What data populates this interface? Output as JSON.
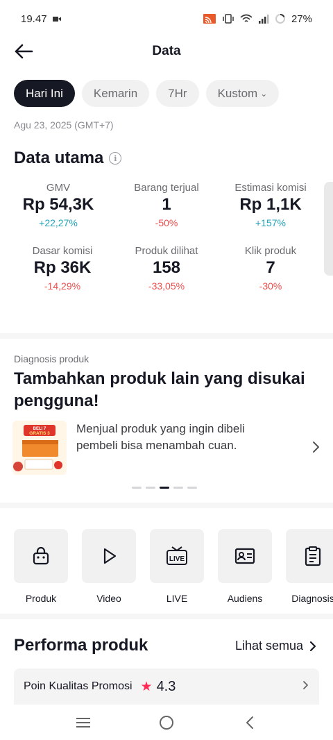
{
  "status_bar": {
    "time": "19.47",
    "battery": "27%"
  },
  "header": {
    "title": "Data"
  },
  "filters": {
    "chips": [
      {
        "label": "Hari Ini"
      },
      {
        "label": "Kemarin"
      },
      {
        "label": "7Hr"
      },
      {
        "label": "Kustom"
      }
    ],
    "selected": "Hari Ini"
  },
  "date_text": "Agu 23, 2025 (GMT+7)",
  "data_utama": {
    "title": "Data utama",
    "metrics": [
      {
        "label": "GMV",
        "value": "Rp 54,3K",
        "change": "+22,27%",
        "trend": "up"
      },
      {
        "label": "Barang terjual",
        "value": "1",
        "change": "-50%",
        "trend": "down"
      },
      {
        "label": "Estimasi komisi",
        "value": "Rp 1,1K",
        "change": "+157%",
        "trend": "up"
      },
      {
        "label": "Dasar komisi",
        "value": "Rp 36K",
        "change": "-14,29%",
        "trend": "down"
      },
      {
        "label": "Produk dilihat",
        "value": "158",
        "change": "-33,05%",
        "trend": "down"
      },
      {
        "label": "Klik produk",
        "value": "7",
        "change": "-30%",
        "trend": "down"
      }
    ]
  },
  "diagnosis": {
    "label": "Diagnosis produk",
    "title": "Tambahkan produk lain yang disukai pengguna!",
    "description": "Menjual produk yang ingin dibeli pembeli bisa menambah cuan.",
    "thumb_text_top": "BELI 7",
    "thumb_text_bottom": "GRATIS 3",
    "slides": 5,
    "active_slide": 2
  },
  "shortcuts": [
    {
      "label": "Produk",
      "icon": "shopping-bag-icon"
    },
    {
      "label": "Video",
      "icon": "play-icon"
    },
    {
      "label": "LIVE",
      "icon": "live-icon",
      "icon_text": "LIVE"
    },
    {
      "label": "Audiens",
      "icon": "id-card-icon"
    },
    {
      "label": "Diagnosis",
      "icon": "clipboard-icon"
    }
  ],
  "performa": {
    "title": "Performa produk",
    "see_all": "Lihat semua",
    "quality_label": "Poin Kualitas Promosi",
    "quality_score": "4.3"
  },
  "colors": {
    "positive": "#20a4b8",
    "negative": "#ee4d4d",
    "star": "#fe2c55",
    "chip_active_bg": "#161823",
    "chip_bg": "#f1f1f2"
  }
}
